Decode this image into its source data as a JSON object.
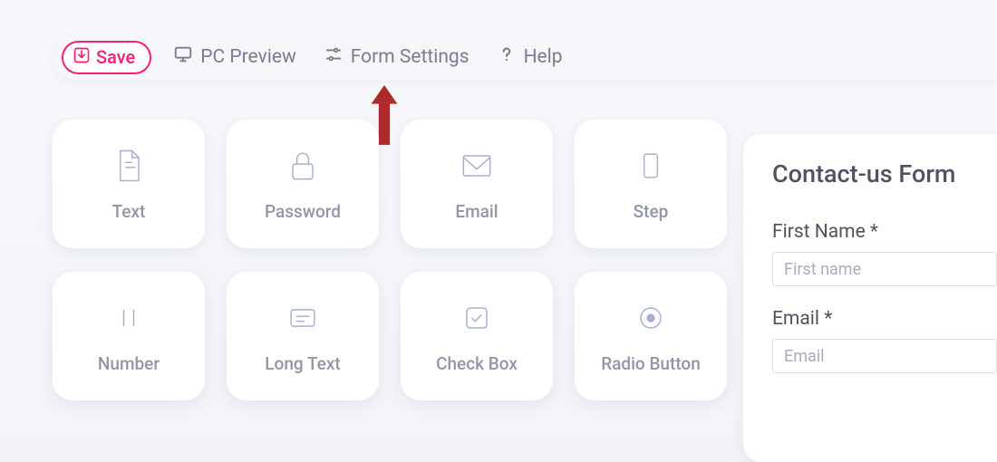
{
  "toolbar": {
    "save_label": "Save",
    "preview_label": "PC Preview",
    "settings_label": "Form Settings",
    "help_label": "Help"
  },
  "palette": [
    {
      "icon": "doc",
      "label": "Text"
    },
    {
      "icon": "lock",
      "label": "Password"
    },
    {
      "icon": "envelope",
      "label": "Email"
    },
    {
      "icon": "step",
      "label": "Step"
    },
    {
      "icon": "number",
      "label": "Number"
    },
    {
      "icon": "longtext",
      "label": "Long Text"
    },
    {
      "icon": "checkbox",
      "label": "Check Box"
    },
    {
      "icon": "radio",
      "label": "Radio Button"
    }
  ],
  "preview": {
    "title": "Contact-us Form",
    "fields": [
      {
        "label": "First Name *",
        "placeholder": "First name"
      },
      {
        "label": "Email *",
        "placeholder": "Email"
      }
    ]
  },
  "annotation": {
    "arrow_points_to": "Form Settings"
  },
  "colors": {
    "save": "#f81f76",
    "icon": "#a7aed6",
    "arrow": "#af2a2a"
  }
}
